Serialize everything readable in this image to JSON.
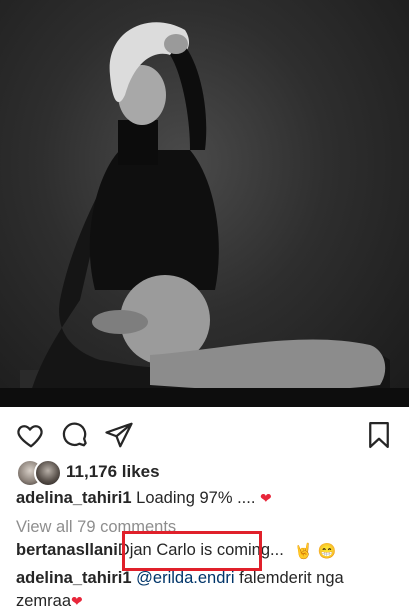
{
  "post": {
    "photo_alt_icon": "portrait-photo",
    "likes": "11,176 likes",
    "caption": {
      "username": "adelina_tahiri1",
      "text": "Loading 97% ....",
      "emoji": "❤"
    },
    "view_all_comments": "View all 79 comments",
    "comments": [
      {
        "username": "bertanasllani",
        "text_highlighted": "Djan Carlo is coming.",
        "text_rest": "..",
        "emojis": [
          "🤘",
          "😁"
        ]
      },
      {
        "username": "adelina_tahiri1",
        "mention": "@erilda.endri",
        "text": "falemderit nga zemraa",
        "emoji": "❤"
      }
    ]
  },
  "icons": {
    "like": "heart-outline-icon",
    "comment": "comment-bubble-icon",
    "share": "paper-plane-icon",
    "save": "bookmark-icon"
  },
  "colors": {
    "heart": "#e8263a",
    "highlight_box": "#e0202a",
    "muted_text": "#8e8e8e",
    "mention": "#003569"
  }
}
